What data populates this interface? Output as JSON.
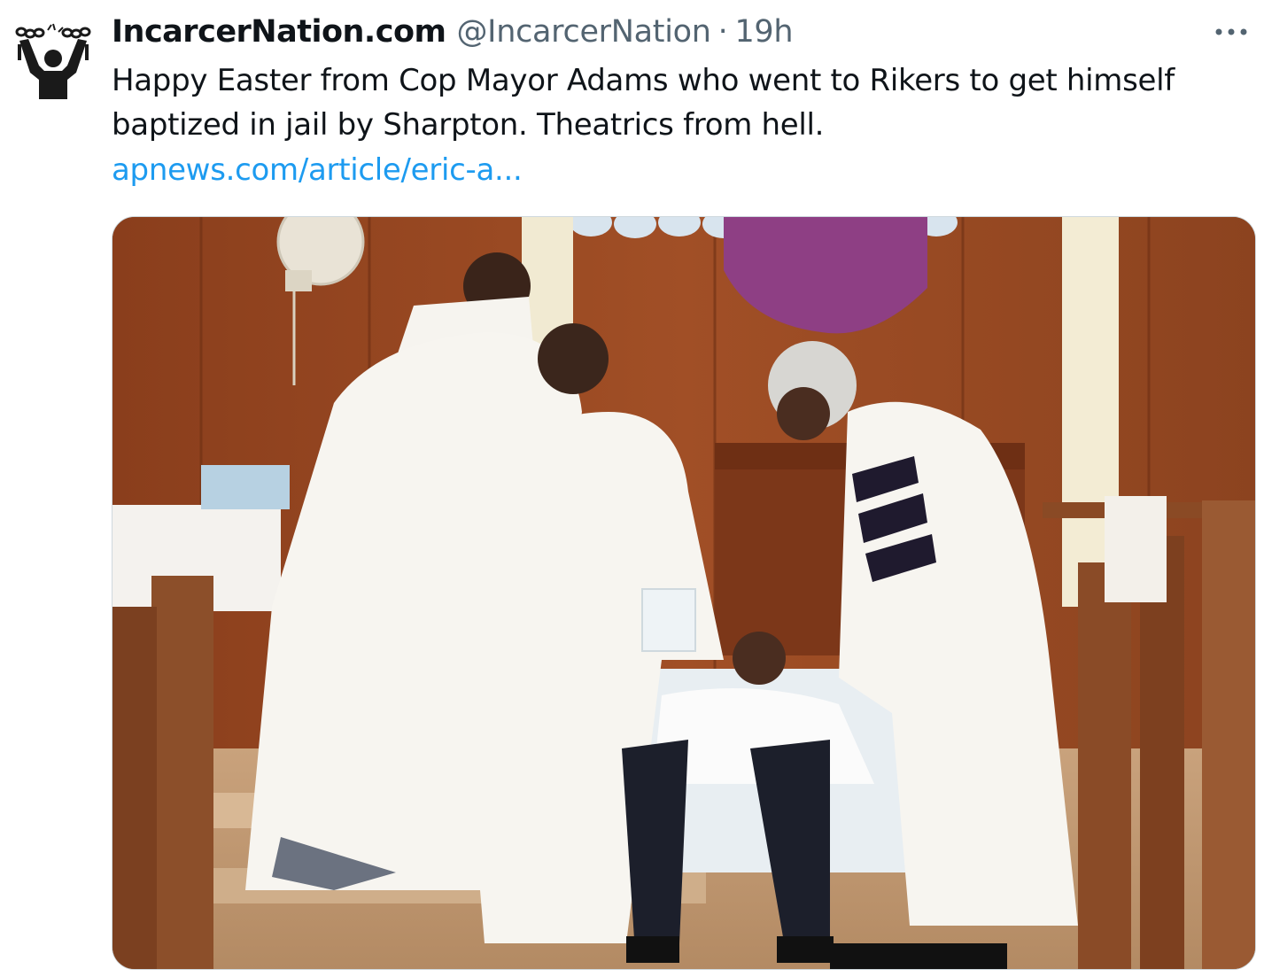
{
  "tweet": {
    "display_name": "IncarcerNation.com",
    "handle": "@IncarcerNation",
    "separator": "·",
    "time": "19h",
    "text": "Happy Easter from Cop Mayor Adams who went to Rikers to get himself baptized in jail by Sharpton. Theatrics from hell.",
    "link_text": "apnews.com/article/eric-a..."
  },
  "icons": {
    "more": "more-horizontal-icon",
    "avatar": "broken-chains-figure-icon"
  },
  "colors": {
    "text_primary": "#0f1419",
    "text_secondary": "#536471",
    "link": "#1d9bf0",
    "media_border": "#cfd9de"
  }
}
